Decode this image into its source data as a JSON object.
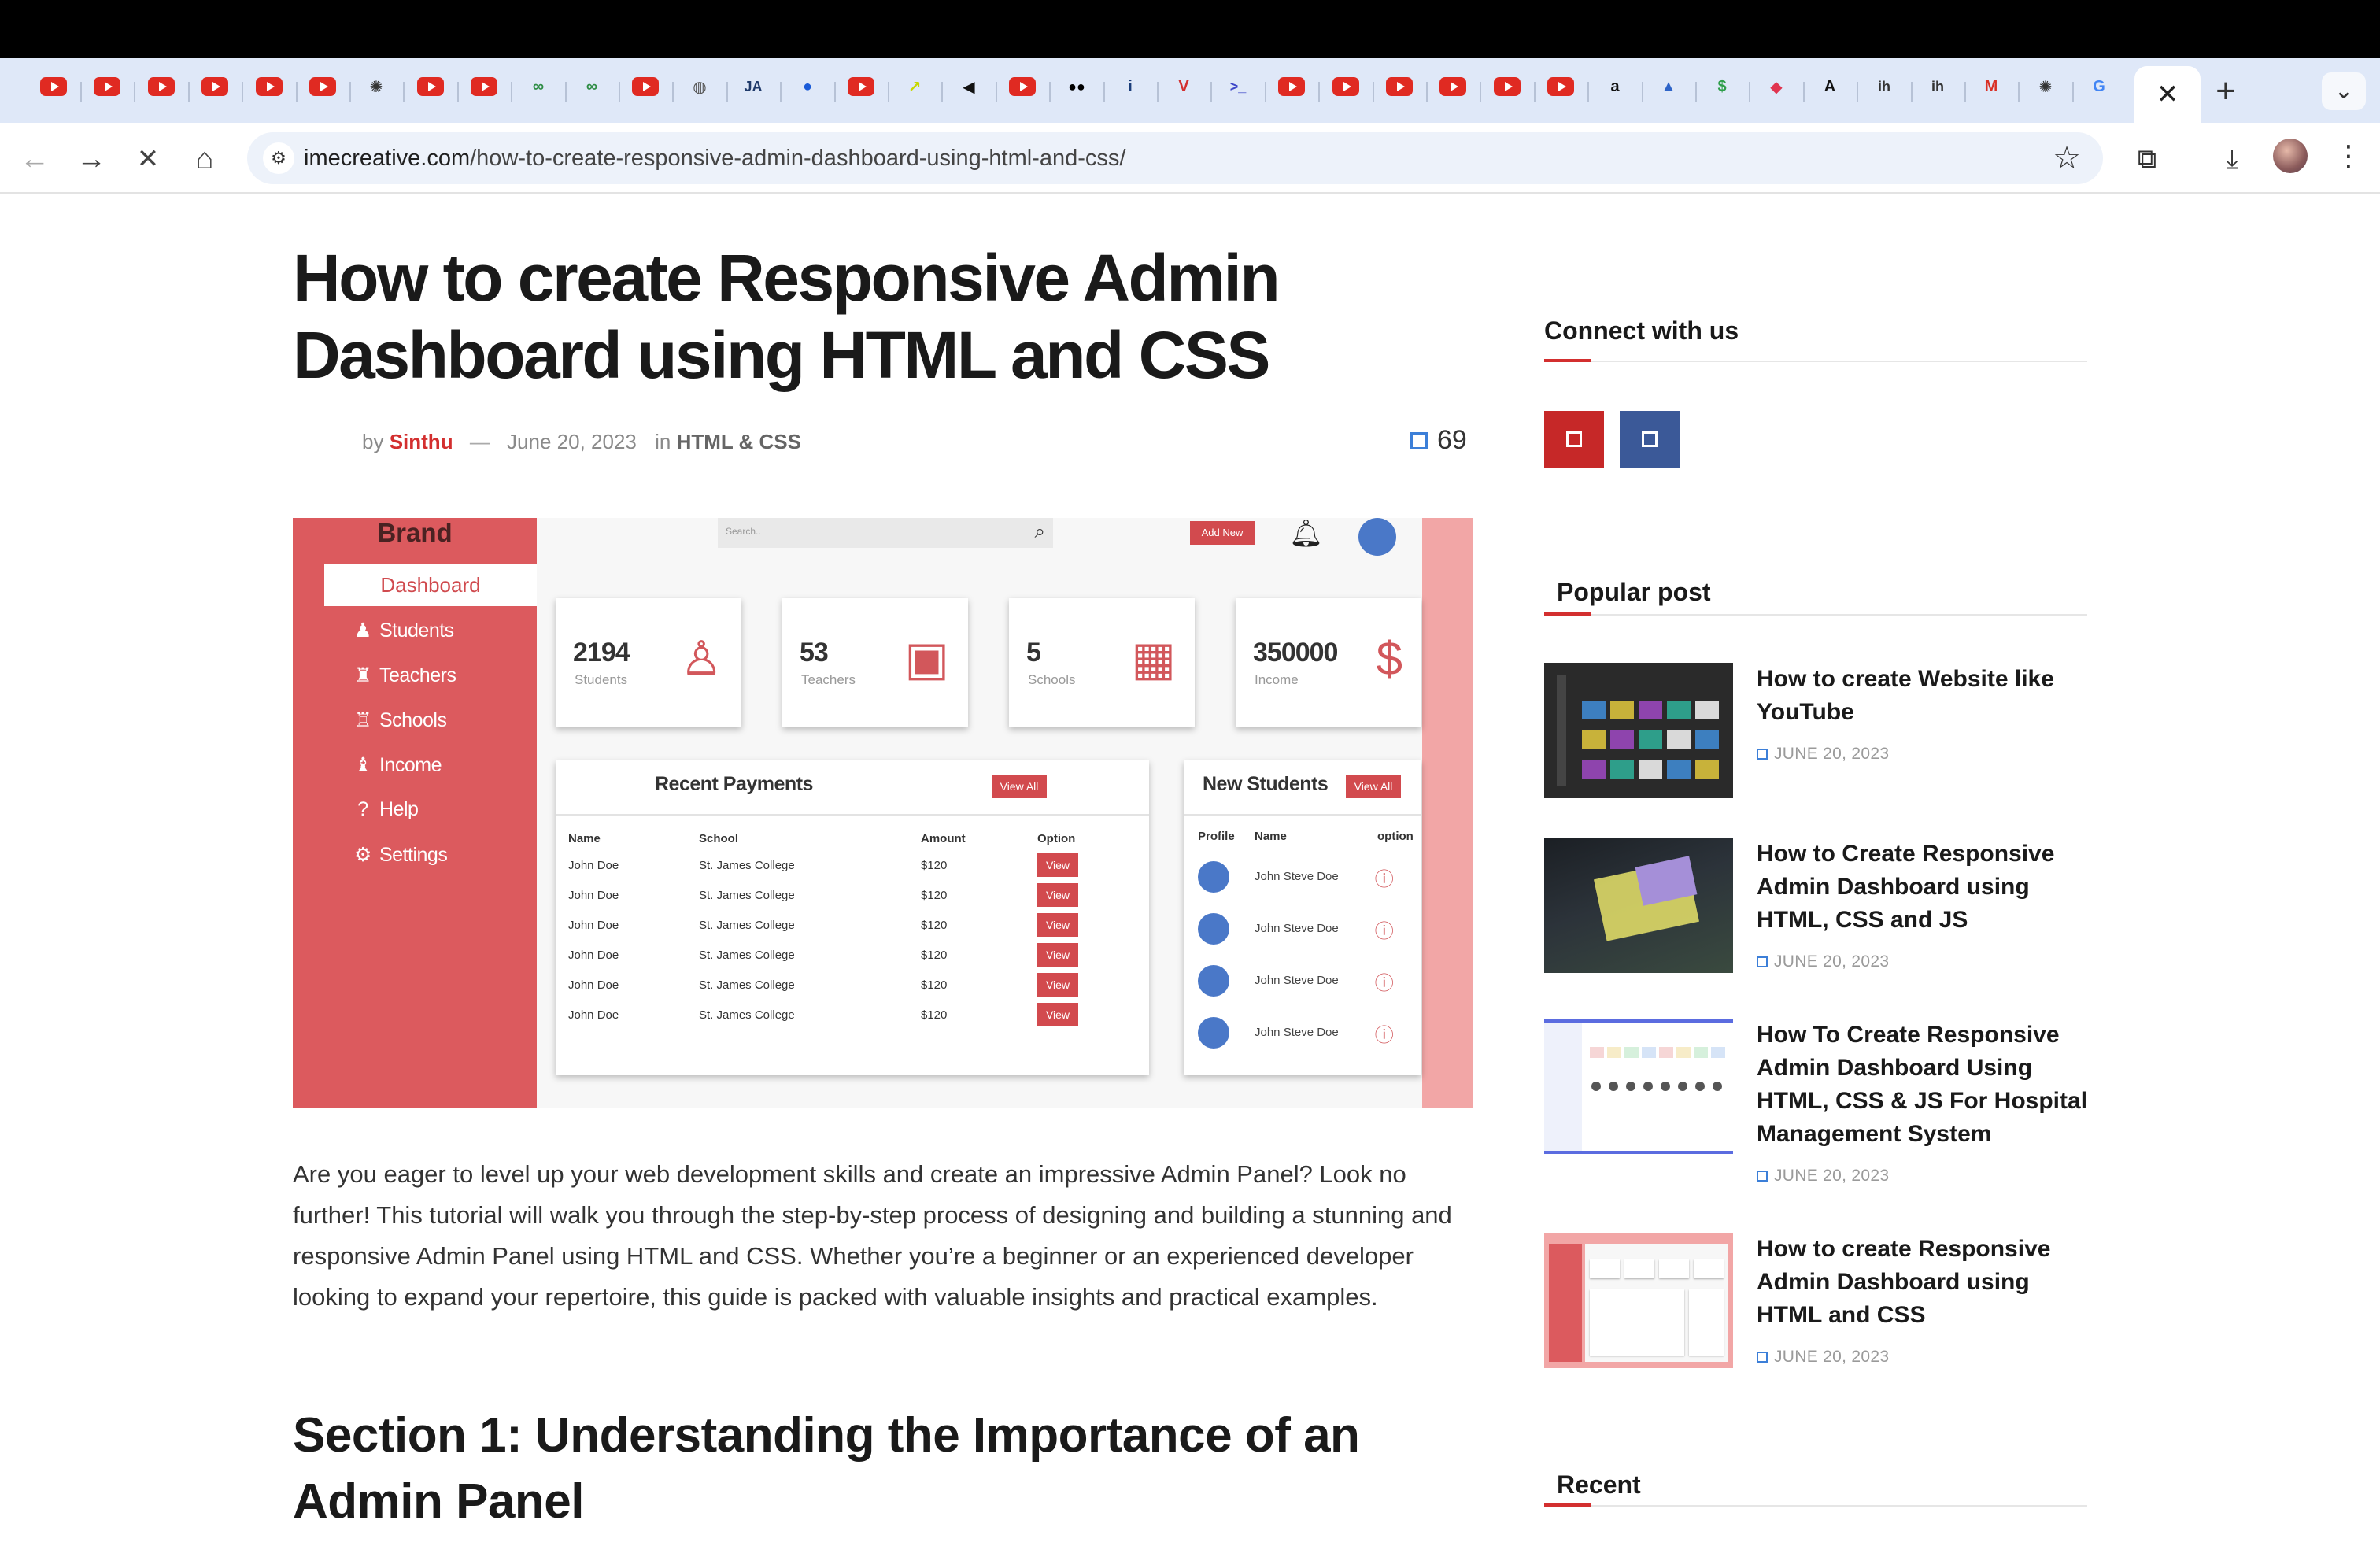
{
  "browser": {
    "tabs": [
      {
        "icon": "youtube-icon",
        "kind": "yt"
      },
      {
        "icon": "youtube-icon",
        "kind": "yt"
      },
      {
        "icon": "youtube-icon",
        "kind": "yt"
      },
      {
        "icon": "youtube-icon",
        "kind": "yt"
      },
      {
        "icon": "youtube-icon",
        "kind": "yt"
      },
      {
        "icon": "youtube-icon",
        "kind": "yt"
      },
      {
        "icon": "openai-icon",
        "kind": "glyph",
        "glyph": "✺",
        "color": "#333333"
      },
      {
        "icon": "youtube-icon",
        "kind": "yt"
      },
      {
        "icon": "youtube-icon",
        "kind": "yt"
      },
      {
        "icon": "geeksforgeeks-icon",
        "kind": "glyph",
        "glyph": "∞",
        "color": "#2f8d46"
      },
      {
        "icon": "geeksforgeeks-icon",
        "kind": "glyph",
        "glyph": "∞",
        "color": "#2f8d46"
      },
      {
        "icon": "youtube-icon",
        "kind": "yt"
      },
      {
        "icon": "globe-icon",
        "kind": "glyph",
        "glyph": "◍",
        "color": "#555555"
      },
      {
        "icon": "ja-icon",
        "kind": "glyph",
        "glyph": "JA",
        "color": "#1f3a6b"
      },
      {
        "icon": "blue-circle-icon",
        "kind": "glyph",
        "glyph": "●",
        "color": "#1a5bd8"
      },
      {
        "icon": "youtube-icon",
        "kind": "yt"
      },
      {
        "icon": "arrow-tile-icon",
        "kind": "glyph",
        "glyph": "↗",
        "color": "#c7d800"
      },
      {
        "icon": "back-tile-icon",
        "kind": "glyph",
        "glyph": "◀",
        "color": "#111111"
      },
      {
        "icon": "youtube-icon",
        "kind": "yt"
      },
      {
        "icon": "medium-icon",
        "kind": "glyph",
        "glyph": "●●",
        "color": "#000000"
      },
      {
        "icon": "info-icon",
        "kind": "glyph",
        "glyph": "i",
        "color": "#1a3d7a"
      },
      {
        "icon": "v-icon",
        "kind": "glyph",
        "glyph": "V",
        "color": "#d32f2f"
      },
      {
        "icon": "terminal-icon",
        "kind": "glyph",
        "glyph": ">_",
        "color": "#3d46c8"
      },
      {
        "icon": "youtube-icon",
        "kind": "yt"
      },
      {
        "icon": "youtube-icon",
        "kind": "yt"
      },
      {
        "icon": "youtube-icon",
        "kind": "yt"
      },
      {
        "icon": "youtube-icon",
        "kind": "yt"
      },
      {
        "icon": "youtube-icon",
        "kind": "yt"
      },
      {
        "icon": "youtube-icon",
        "kind": "yt"
      },
      {
        "icon": "amazon-icon",
        "kind": "glyph",
        "glyph": "a",
        "color": "#111111"
      },
      {
        "icon": "triangle-icon",
        "kind": "glyph",
        "glyph": "▲",
        "color": "#2e64c8"
      },
      {
        "icon": "dollar-icon",
        "kind": "glyph",
        "glyph": "$",
        "color": "#2e9e4a"
      },
      {
        "icon": "cube-icon",
        "kind": "glyph",
        "glyph": "◆",
        "color": "#e0344f"
      },
      {
        "icon": "dev-icon",
        "kind": "glyph",
        "glyph": "A",
        "color": "#111111"
      },
      {
        "icon": "ih-icon",
        "kind": "glyph",
        "glyph": "ih",
        "color": "#333333"
      },
      {
        "icon": "ih-icon",
        "kind": "glyph",
        "glyph": "ih",
        "color": "#333333"
      },
      {
        "icon": "gmail-icon",
        "kind": "glyph",
        "glyph": "M",
        "color": "#d93025"
      },
      {
        "icon": "openai-icon",
        "kind": "glyph",
        "glyph": "✺",
        "color": "#333333"
      },
      {
        "icon": "google-icon",
        "kind": "glyph",
        "glyph": "G",
        "color": "#4285f4"
      }
    ],
    "url_host": "imecreative.com",
    "url_path": "/how-to-create-responsive-admin-dashboard-using-html-and-css/"
  },
  "article": {
    "title": "How to create Responsive Admin Dashboard using HTML and CSS",
    "by": "by",
    "author": "Sinthu",
    "dash": "—",
    "date": "June 20, 2023",
    "in": "in",
    "category": "HTML & CSS",
    "comment_count": "69",
    "intro": "Are you eager to level up your web development skills and create an impressive Admin Panel? Look no further! This tutorial will walk you through the step-by-step process of designing and building a stunning and responsive Admin Panel using HTML and CSS. Whether you’re a beginner or an experienced developer looking to expand your repertoire, this guide is packed with valuable insights and practical examples.",
    "section1": "Section 1: Understanding the Importance of an Admin Panel"
  },
  "hero": {
    "brand": "Brand",
    "dashboard": "Dashboard",
    "nav": [
      {
        "label": "Students",
        "icon": "student-icon",
        "glyph": "♟"
      },
      {
        "label": "Teachers",
        "icon": "teacher-icon",
        "glyph": "♜"
      },
      {
        "label": "Schools",
        "icon": "school-icon",
        "glyph": "♖"
      },
      {
        "label": "Income",
        "icon": "income-icon",
        "glyph": "♝"
      },
      {
        "label": "Help",
        "icon": "help-icon",
        "glyph": "?"
      },
      {
        "label": "Settings",
        "icon": "settings-icon",
        "glyph": "⚙"
      }
    ],
    "search_placeholder": "Search..",
    "add_new": "Add New",
    "cards": [
      {
        "num": "2194",
        "label": "Students",
        "icon": "student-card-icon",
        "glyph": "♙"
      },
      {
        "num": "53",
        "label": "Teachers",
        "icon": "teacher-card-icon",
        "glyph": "▣"
      },
      {
        "num": "5",
        "label": "Schools",
        "icon": "school-card-icon",
        "glyph": "▦"
      },
      {
        "num": "350000",
        "label": "Income",
        "icon": "income-card-icon",
        "glyph": "$"
      }
    ],
    "payments": {
      "title": "Recent Payments",
      "view_all": "View All",
      "headers": [
        "Name",
        "School",
        "Amount",
        "Option"
      ],
      "rows": [
        [
          "John Doe",
          "St. James College",
          "$120",
          "View"
        ],
        [
          "John Doe",
          "St. James College",
          "$120",
          "View"
        ],
        [
          "John Doe",
          "St. James College",
          "$120",
          "View"
        ],
        [
          "John Doe",
          "St. James College",
          "$120",
          "View"
        ],
        [
          "John Doe",
          "St. James College",
          "$120",
          "View"
        ],
        [
          "John Doe",
          "St. James College",
          "$120",
          "View"
        ]
      ]
    },
    "students": {
      "title": "New Students",
      "view_all": "View All",
      "headers": [
        "Profile",
        "Name",
        "option"
      ],
      "rows": [
        "John Steve Doe",
        "John Steve Doe",
        "John Steve Doe",
        "John Steve Doe"
      ]
    }
  },
  "sidebar": {
    "connect_title": "Connect with us",
    "social": [
      {
        "icon": "social-red-icon",
        "color": "#c62828"
      },
      {
        "icon": "social-blue-icon",
        "color": "#3b5998"
      }
    ],
    "popular_title": "Popular post",
    "posts": [
      {
        "title": "How to create Website like YouTube",
        "date": "JUNE 20, 2023",
        "thumb": "youtube-clone-thumbnail"
      },
      {
        "title": "How to Create Responsive Admin Dashboard using HTML, CSS and JS",
        "date": "JUNE 20, 2023",
        "thumb": "dark-dashboard-thumbnail"
      },
      {
        "title": "How To Create Responsive Admin Dashboard Using HTML, CSS & JS For Hospital Management System",
        "date": "JUNE 20, 2023",
        "thumb": "hospital-dashboard-thumbnail"
      },
      {
        "title": "How to create Responsive Admin Dashboard using HTML and CSS",
        "date": "JUNE 20, 2023",
        "thumb": "pink-dashboard-thumbnail"
      }
    ],
    "recent_title": "Recent"
  }
}
